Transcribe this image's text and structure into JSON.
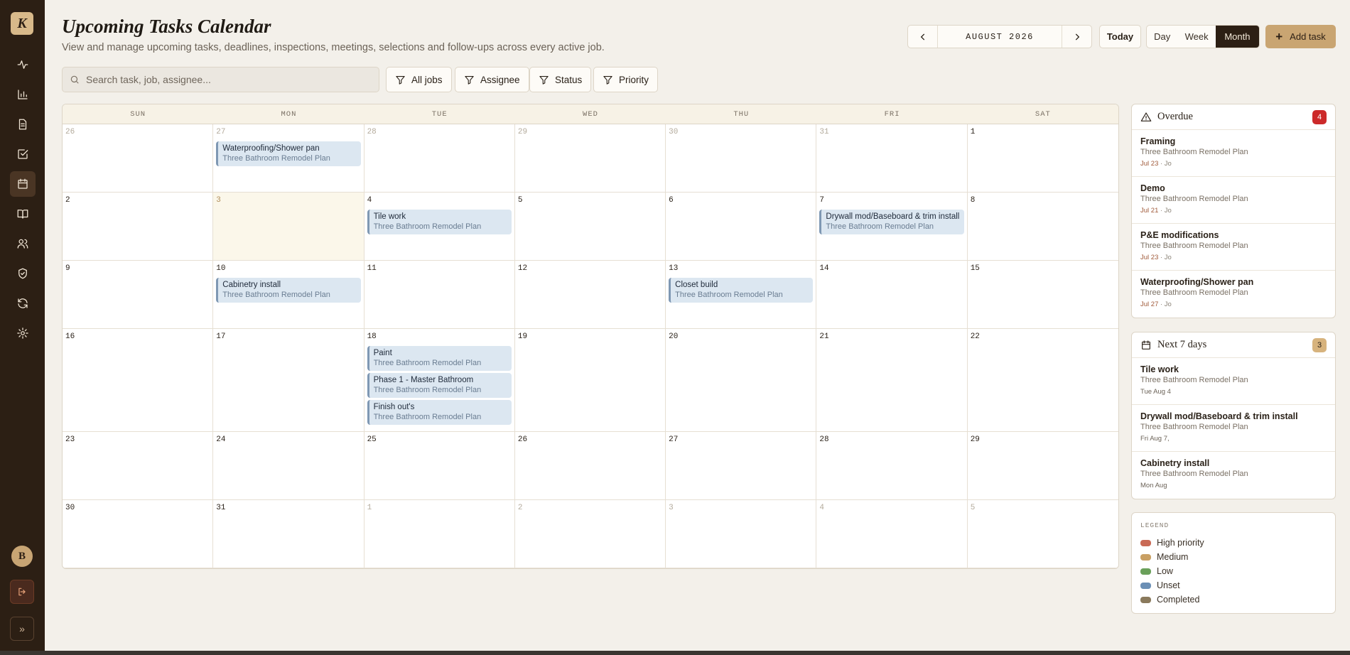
{
  "app": {
    "logo_letter": "K",
    "user_initial": "B"
  },
  "sidebar": {
    "items": [
      {
        "icon": "activity-icon"
      },
      {
        "icon": "bar-chart-icon"
      },
      {
        "icon": "document-icon"
      },
      {
        "icon": "checkbox-icon"
      },
      {
        "icon": "calendar-icon",
        "active": true
      },
      {
        "icon": "book-icon"
      },
      {
        "icon": "users-icon"
      },
      {
        "icon": "shield-icon"
      },
      {
        "icon": "refresh-icon"
      },
      {
        "icon": "gear-icon"
      }
    ],
    "logout_icon": "logout-icon",
    "expand_label": "»"
  },
  "header": {
    "title": "Upcoming Tasks Calendar",
    "subtitle": "View and manage upcoming tasks, deadlines, inspections, meetings, selections and follow-ups across every active job.",
    "month_label": "AUGUST 2026",
    "today_label": "Today",
    "views": {
      "day": "Day",
      "week": "Week",
      "month": "Month"
    },
    "active_view": "Month",
    "add_task_label": "Add task"
  },
  "search": {
    "placeholder": "Search task, job, assignee...",
    "value": ""
  },
  "filters": {
    "jobs": "All jobs",
    "assignee": "Assignee",
    "status": "Status",
    "priority": "Priority"
  },
  "calendar": {
    "weekdays": [
      "SUN",
      "MON",
      "TUE",
      "WED",
      "THU",
      "FRI",
      "SAT"
    ],
    "days": [
      {
        "n": "26",
        "muted": true
      },
      {
        "n": "27",
        "muted": true
      },
      {
        "n": "28",
        "muted": true
      },
      {
        "n": "29",
        "muted": true
      },
      {
        "n": "30",
        "muted": true
      },
      {
        "n": "31",
        "muted": true
      },
      {
        "n": "1"
      },
      {
        "n": "2"
      },
      {
        "n": "3",
        "today": true
      },
      {
        "n": "4"
      },
      {
        "n": "5"
      },
      {
        "n": "6"
      },
      {
        "n": "7"
      },
      {
        "n": "8"
      },
      {
        "n": "9"
      },
      {
        "n": "10"
      },
      {
        "n": "11"
      },
      {
        "n": "12"
      },
      {
        "n": "13"
      },
      {
        "n": "14"
      },
      {
        "n": "15"
      },
      {
        "n": "16"
      },
      {
        "n": "17"
      },
      {
        "n": "18"
      },
      {
        "n": "19"
      },
      {
        "n": "20"
      },
      {
        "n": "21"
      },
      {
        "n": "22"
      },
      {
        "n": "23"
      },
      {
        "n": "24"
      },
      {
        "n": "25"
      },
      {
        "n": "26"
      },
      {
        "n": "27"
      },
      {
        "n": "28"
      },
      {
        "n": "29"
      },
      {
        "n": "30"
      },
      {
        "n": "31"
      },
      {
        "n": "1",
        "muted": true
      },
      {
        "n": "2",
        "muted": true
      },
      {
        "n": "3",
        "muted": true
      },
      {
        "n": "4",
        "muted": true
      },
      {
        "n": "5",
        "muted": true
      }
    ],
    "events": [
      {
        "cell": 1,
        "title": "Waterproofing/Shower pan",
        "job": "Three Bathroom Remodel Plan"
      },
      {
        "cell": 9,
        "title": "Tile work",
        "job": "Three Bathroom Remodel Plan"
      },
      {
        "cell": 12,
        "title": "Drywall mod/Baseboard & trim install",
        "job": "Three Bathroom Remodel Plan"
      },
      {
        "cell": 15,
        "title": "Cabinetry install",
        "job": "Three Bathroom Remodel Plan"
      },
      {
        "cell": 18,
        "title": "Closet build",
        "job": "Three Bathroom Remodel Plan"
      },
      {
        "cell": 23,
        "title": "Paint",
        "job": "Three Bathroom Remodel Plan"
      },
      {
        "cell": 23,
        "title": "Phase 1 - Master Bathroom",
        "job": "Three Bathroom Remodel Plan"
      },
      {
        "cell": 23,
        "title": "Finish out's",
        "job": "Three Bathroom Remodel Plan"
      }
    ]
  },
  "overdue": {
    "title": "Overdue",
    "count": "4",
    "items": [
      {
        "title": "Framing",
        "job": "Three Bathroom Remodel Plan",
        "date": "Jul 23",
        "assignee": "· Jo"
      },
      {
        "title": "Demo",
        "job": "Three Bathroom Remodel Plan",
        "date": "Jul 21",
        "assignee": "· Jo"
      },
      {
        "title": "P&E modifications",
        "job": "Three Bathroom Remodel Plan",
        "date": "Jul 23",
        "assignee": "· Jo"
      },
      {
        "title": "Waterproofing/Shower pan",
        "job": "Three Bathroom Remodel Plan",
        "date": "Jul 27",
        "assignee": "· Jo"
      }
    ]
  },
  "next7": {
    "title": "Next 7 days",
    "count": "3",
    "items": [
      {
        "title": "Tile work",
        "job": "Three Bathroom Remodel Plan",
        "date": "Tue Aug 4"
      },
      {
        "title": "Drywall mod/Baseboard & trim install",
        "job": "Three Bathroom Remodel Plan",
        "date": "Fri Aug 7,"
      },
      {
        "title": "Cabinetry install",
        "job": "Three Bathroom Remodel Plan",
        "date": "Mon Aug"
      }
    ]
  },
  "legend": {
    "title": "LEGEND",
    "items": [
      {
        "label": "High priority",
        "color": "#c96a55"
      },
      {
        "label": "Medium",
        "color": "#c9a064"
      },
      {
        "label": "Low",
        "color": "#6aa05a"
      },
      {
        "label": "Unset",
        "color": "#6b8fb5"
      },
      {
        "label": "Completed",
        "color": "#8a7a5c"
      }
    ]
  }
}
